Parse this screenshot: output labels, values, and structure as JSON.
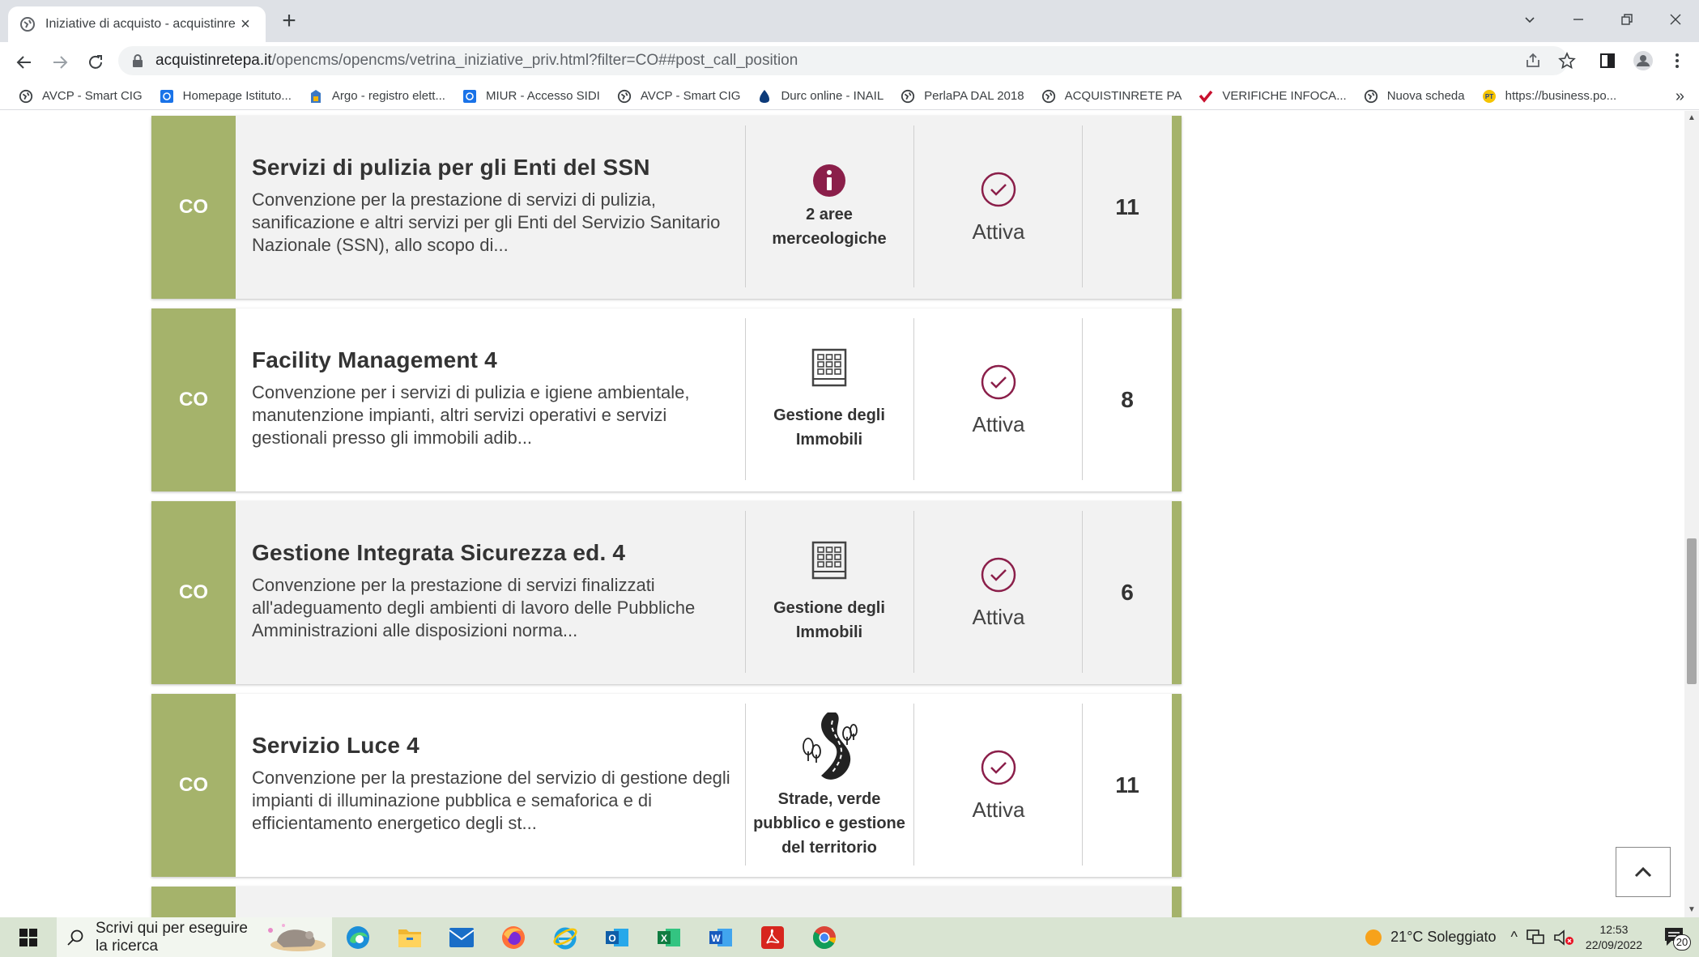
{
  "browser": {
    "tab_title": "Iniziative di acquisto - acquistinre",
    "url_host": "acquistinretepa.it",
    "url_path": "/opencms/opencms/vetrina_iniziative_priv.html?filter=CO##post_call_position",
    "bookmarks": [
      {
        "label": "AVCP - Smart CIG",
        "icon": "globe-icon"
      },
      {
        "label": "Homepage Istituto...",
        "icon": "school-icon"
      },
      {
        "label": "Argo - registro elett...",
        "icon": "argo-icon"
      },
      {
        "label": "MIUR - Accesso SIDI",
        "icon": "miur-icon"
      },
      {
        "label": "AVCP - Smart CIG",
        "icon": "globe-icon"
      },
      {
        "label": "Durc online - INAIL",
        "icon": "inail-icon"
      },
      {
        "label": "PerlaPA DAL 2018",
        "icon": "globe-icon"
      },
      {
        "label": "ACQUISTINRETE PA",
        "icon": "globe-icon"
      },
      {
        "label": "VERIFICHE INFOCA...",
        "icon": "infocamere-icon"
      },
      {
        "label": "Nuova scheda",
        "icon": "globe-icon"
      },
      {
        "label": "https://business.po...",
        "icon": "poste-icon"
      }
    ],
    "bookmarks_more": "»"
  },
  "cards": [
    {
      "code": "CO",
      "title": "Servizi di pulizia per gli Enti del SSN",
      "description": "Convenzione per la prestazione di servizi di pulizia, sanificazione e altri servizi per gli Enti del Servizio Sanitario Nazionale (SSN), allo scopo di...",
      "category_line1": "2 aree",
      "category_line2": "merceologiche",
      "category_icon": "info-icon",
      "status": "Attiva",
      "count": "11"
    },
    {
      "code": "CO",
      "title": "Facility Management 4",
      "description": "Convenzione per i servizi di pulizia e igiene ambientale, manutenzione impianti, altri servizi operativi e servizi gestionali presso gli immobili adib...",
      "category_line1": "Gestione degli",
      "category_line2": "Immobili",
      "category_icon": "building-icon",
      "status": "Attiva",
      "count": "8"
    },
    {
      "code": "CO",
      "title": "Gestione Integrata Sicurezza ed. 4",
      "description": "Convenzione per la prestazione di servizi finalizzati all'adeguamento degli ambienti di lavoro delle Pubbliche Amministrazioni alle disposizioni norma...",
      "category_line1": "Gestione degli",
      "category_line2": "Immobili",
      "category_icon": "building-icon",
      "status": "Attiva",
      "count": "6"
    },
    {
      "code": "CO",
      "title": "Servizio Luce 4",
      "description": "Convenzione per la prestazione del servizio di gestione degli impianti di illuminazione pubblica e semaforica e di efficientamento energetico degli st...",
      "category_line1": "Strade, verde",
      "category_line2": "pubblico e gestione",
      "category_line3": "del territorio",
      "category_icon": "road-tree-icon",
      "status": "Attiva",
      "count": "11"
    }
  ],
  "taskbar": {
    "search_placeholder": "Scrivi qui per eseguire la ricerca",
    "weather": "21°C  Soleggiato",
    "time": "12:53",
    "date": "22/09/2022",
    "notifications": "20"
  },
  "colors": {
    "accent_green": "#a5b36b",
    "status_purple": "#8b1f4a"
  }
}
